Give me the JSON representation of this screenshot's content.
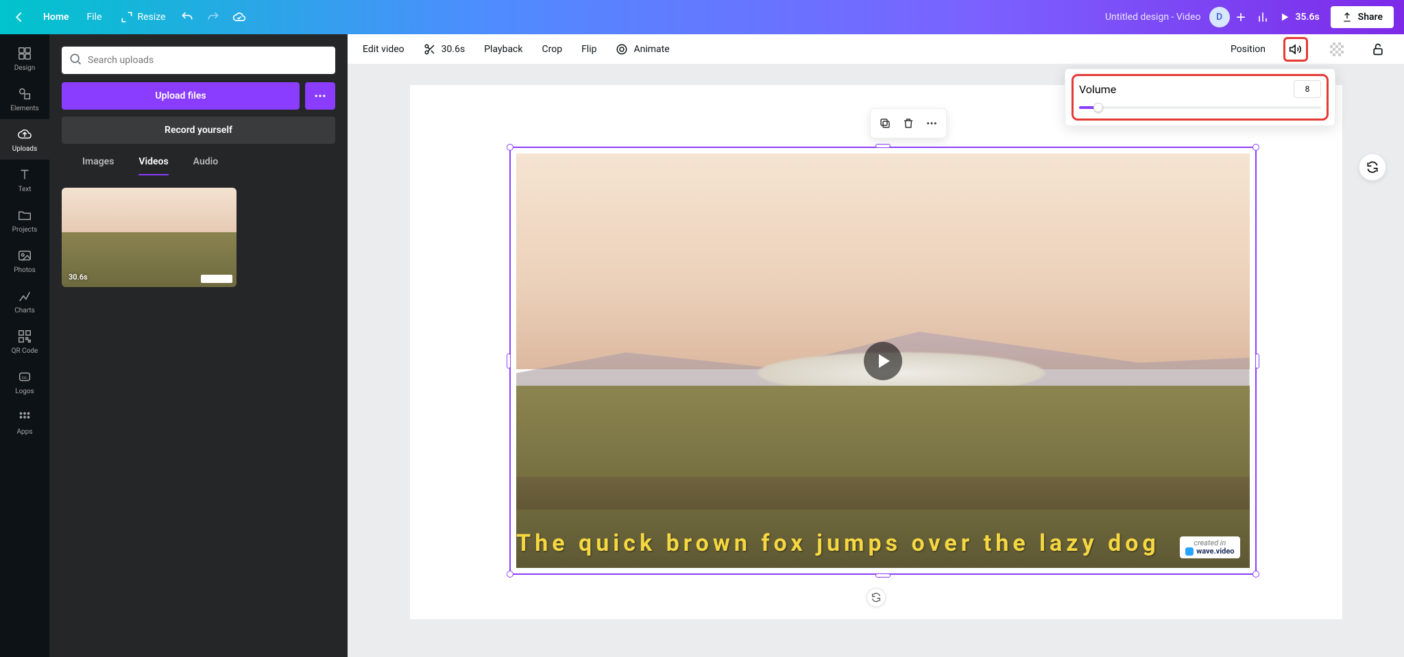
{
  "header": {
    "home": "Home",
    "file": "File",
    "resize": "Resize",
    "title": "Untitled design - Video",
    "avatar_letter": "D",
    "duration": "35.6s",
    "share": "Share"
  },
  "rail": {
    "items": [
      {
        "label": "Design"
      },
      {
        "label": "Elements"
      },
      {
        "label": "Uploads"
      },
      {
        "label": "Text"
      },
      {
        "label": "Projects"
      },
      {
        "label": "Photos"
      },
      {
        "label": "Charts"
      },
      {
        "label": "QR Code"
      },
      {
        "label": "Logos"
      },
      {
        "label": "Apps"
      }
    ],
    "active_index": 2
  },
  "side": {
    "search_placeholder": "Search uploads",
    "upload": "Upload files",
    "record": "Record yourself",
    "tabs": [
      "Images",
      "Videos",
      "Audio"
    ],
    "active_tab": 1,
    "uploads": [
      {
        "duration": "30.6s"
      }
    ]
  },
  "toolbar": {
    "edit_video": "Edit video",
    "clip_duration": "30.6s",
    "playback": "Playback",
    "crop": "Crop",
    "flip": "Flip",
    "animate": "Animate",
    "position": "Position"
  },
  "volume_popover": {
    "label": "Volume",
    "value": "8",
    "percent": 8
  },
  "canvas": {
    "caption": "The quick brown fox jumps over the lazy dog",
    "watermark_top": "created in",
    "watermark_name": "wave.video"
  }
}
